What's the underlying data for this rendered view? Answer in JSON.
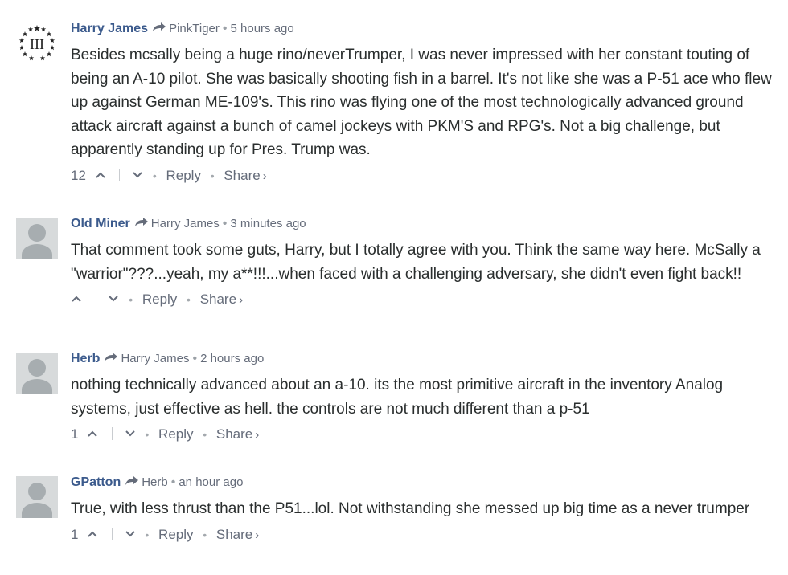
{
  "comments": [
    {
      "author": "Harry James",
      "parent": "PinkTiger",
      "time": "5 hours ago",
      "avatar": "III",
      "text": "Besides mcsally being a huge rino/neverTrumper, I was never impressed with her constant touting of being an A-10 pilot. She was basically shooting fish in a barrel. It's not like she was a P-51 ace who flew up against German ME-109's. This rino was flying one of the most technologically advanced ground attack aircraft against a bunch of camel jockeys with PKM'S and RPG's. Not a big challenge, but apparently standing up for Pres. Trump was.",
      "votes": "12",
      "reply": "Reply",
      "share": "Share",
      "share_chevron": "›"
    },
    {
      "author": "Old Miner",
      "parent": "Harry James",
      "time": "3 minutes ago",
      "text": "That comment took some guts, Harry, but I totally agree with you. Think the same way here. McSally a \"warrior\"???...yeah, my a**!!!...when faced with a challenging adversary, she didn't even fight back!!",
      "votes": "",
      "reply": "Reply",
      "share": "Share",
      "share_chevron": "›"
    },
    {
      "author": "Herb",
      "parent": "Harry James",
      "time": "2 hours ago",
      "text": "nothing technically advanced about an a-10. its the most primitive aircraft in the inventory Analog systems, just effective as hell. the controls are not much different than a p-51",
      "votes": "1",
      "reply": "Reply",
      "share": "Share",
      "share_chevron": "›"
    },
    {
      "author": "GPatton",
      "parent": "Herb",
      "time": "an hour ago",
      "text": "True, with less thrust than the P51...lol. Not withstanding she messed up big time as a never trumper",
      "votes": "1",
      "reply": "Reply",
      "share": "Share",
      "share_chevron": "›"
    }
  ],
  "separator_dot": "•",
  "colors": {
    "author": "#3b5a8c",
    "meta": "#656c7a",
    "text": "#2a2e2e",
    "avatar_bg": "#d7dadb"
  },
  "icons": {
    "reply_to": "reply-arrow-icon",
    "upvote": "chevron-up-icon",
    "downvote": "chevron-down-icon"
  }
}
